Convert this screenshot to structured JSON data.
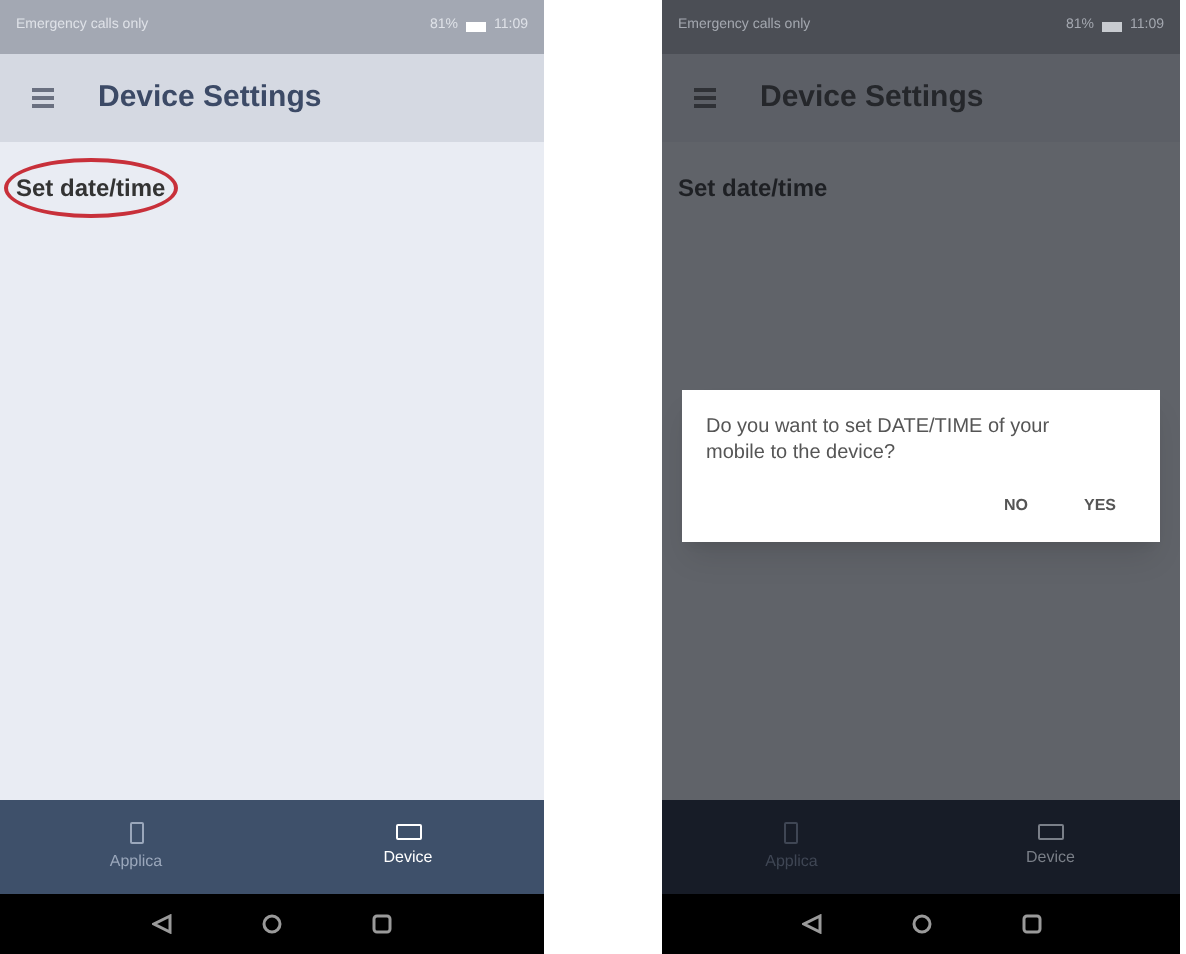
{
  "screens": [
    {
      "status_bar": {
        "carrier": "Emergency calls only",
        "battery": "81%",
        "time": "11:09"
      },
      "title": "Device Settings",
      "items": [
        {
          "label": "Set date/time",
          "circled": true
        }
      ],
      "bottom_nav": [
        {
          "label": "Applica",
          "selected": false
        },
        {
          "label": "Device",
          "selected": true
        }
      ]
    },
    {
      "status_bar": {
        "carrier": "Emergency calls only",
        "battery": "81%",
        "time": "11:09"
      },
      "title": "Device Settings",
      "items": [
        {
          "label": "Set date/time",
          "circled": false
        }
      ],
      "bottom_nav": [
        {
          "label": "Applica",
          "selected": false
        },
        {
          "label": "Device",
          "selected": true
        }
      ],
      "dialog": {
        "message": "Do you want to set DATE/TIME of your mobile to the device?",
        "buttons": [
          "NO",
          "YES"
        ]
      }
    }
  ]
}
